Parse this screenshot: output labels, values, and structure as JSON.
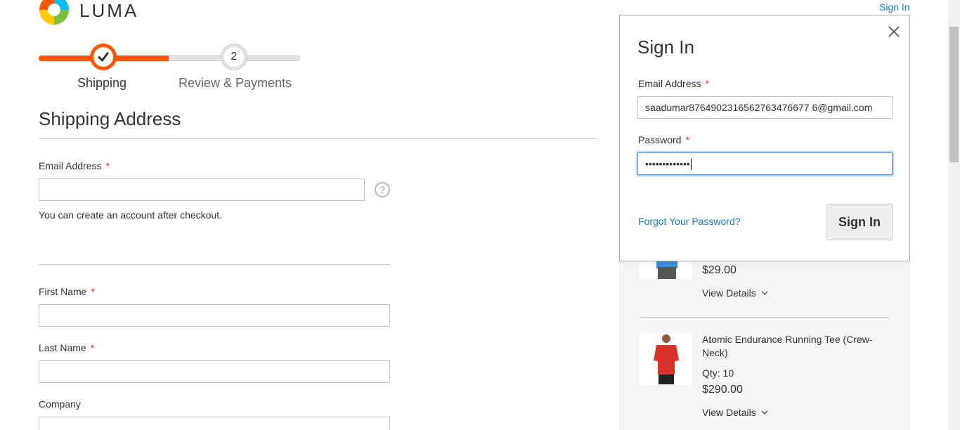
{
  "header": {
    "brand": "LUMA",
    "sign_in_link": "Sign In",
    "brand_colors": [
      "#ff5501",
      "#00c0f3",
      "#7fbf3f",
      "#ffcc00"
    ]
  },
  "progress": {
    "steps": [
      {
        "label": "Shipping",
        "state": "complete",
        "icon": "checkmark-icon"
      },
      {
        "label": "Review & Payments",
        "number": "2",
        "state": "pending"
      }
    ],
    "accent": "#ff5501"
  },
  "shipping": {
    "title": "Shipping Address",
    "email_label": "Email Address",
    "email_value": "",
    "required_mark": "*",
    "help_icon": "question-icon",
    "note": "You can create an account after checkout.",
    "first_name_label": "First Name",
    "first_name_value": "",
    "last_name_label": "Last Name",
    "last_name_value": "",
    "company_label": "Company",
    "company_value": ""
  },
  "summary": {
    "items": [
      {
        "price": "$29.00",
        "details_label": "View Details"
      },
      {
        "name": "Atomic Endurance Running Tee (Crew-Neck)",
        "qty": "Qty: 10",
        "price": "$290.00",
        "details_label": "View Details"
      }
    ]
  },
  "signin_modal": {
    "title": "Sign In",
    "email_label": "Email Address",
    "email_value": "saadumar8764902316562763476677 6@gmail.com",
    "password_label": "Password",
    "password_masked": "•••••••••••••",
    "forgot_label": "Forgot Your Password?",
    "button_label": "Sign In",
    "close_icon": "close-icon",
    "link_color": "#1979c3"
  }
}
